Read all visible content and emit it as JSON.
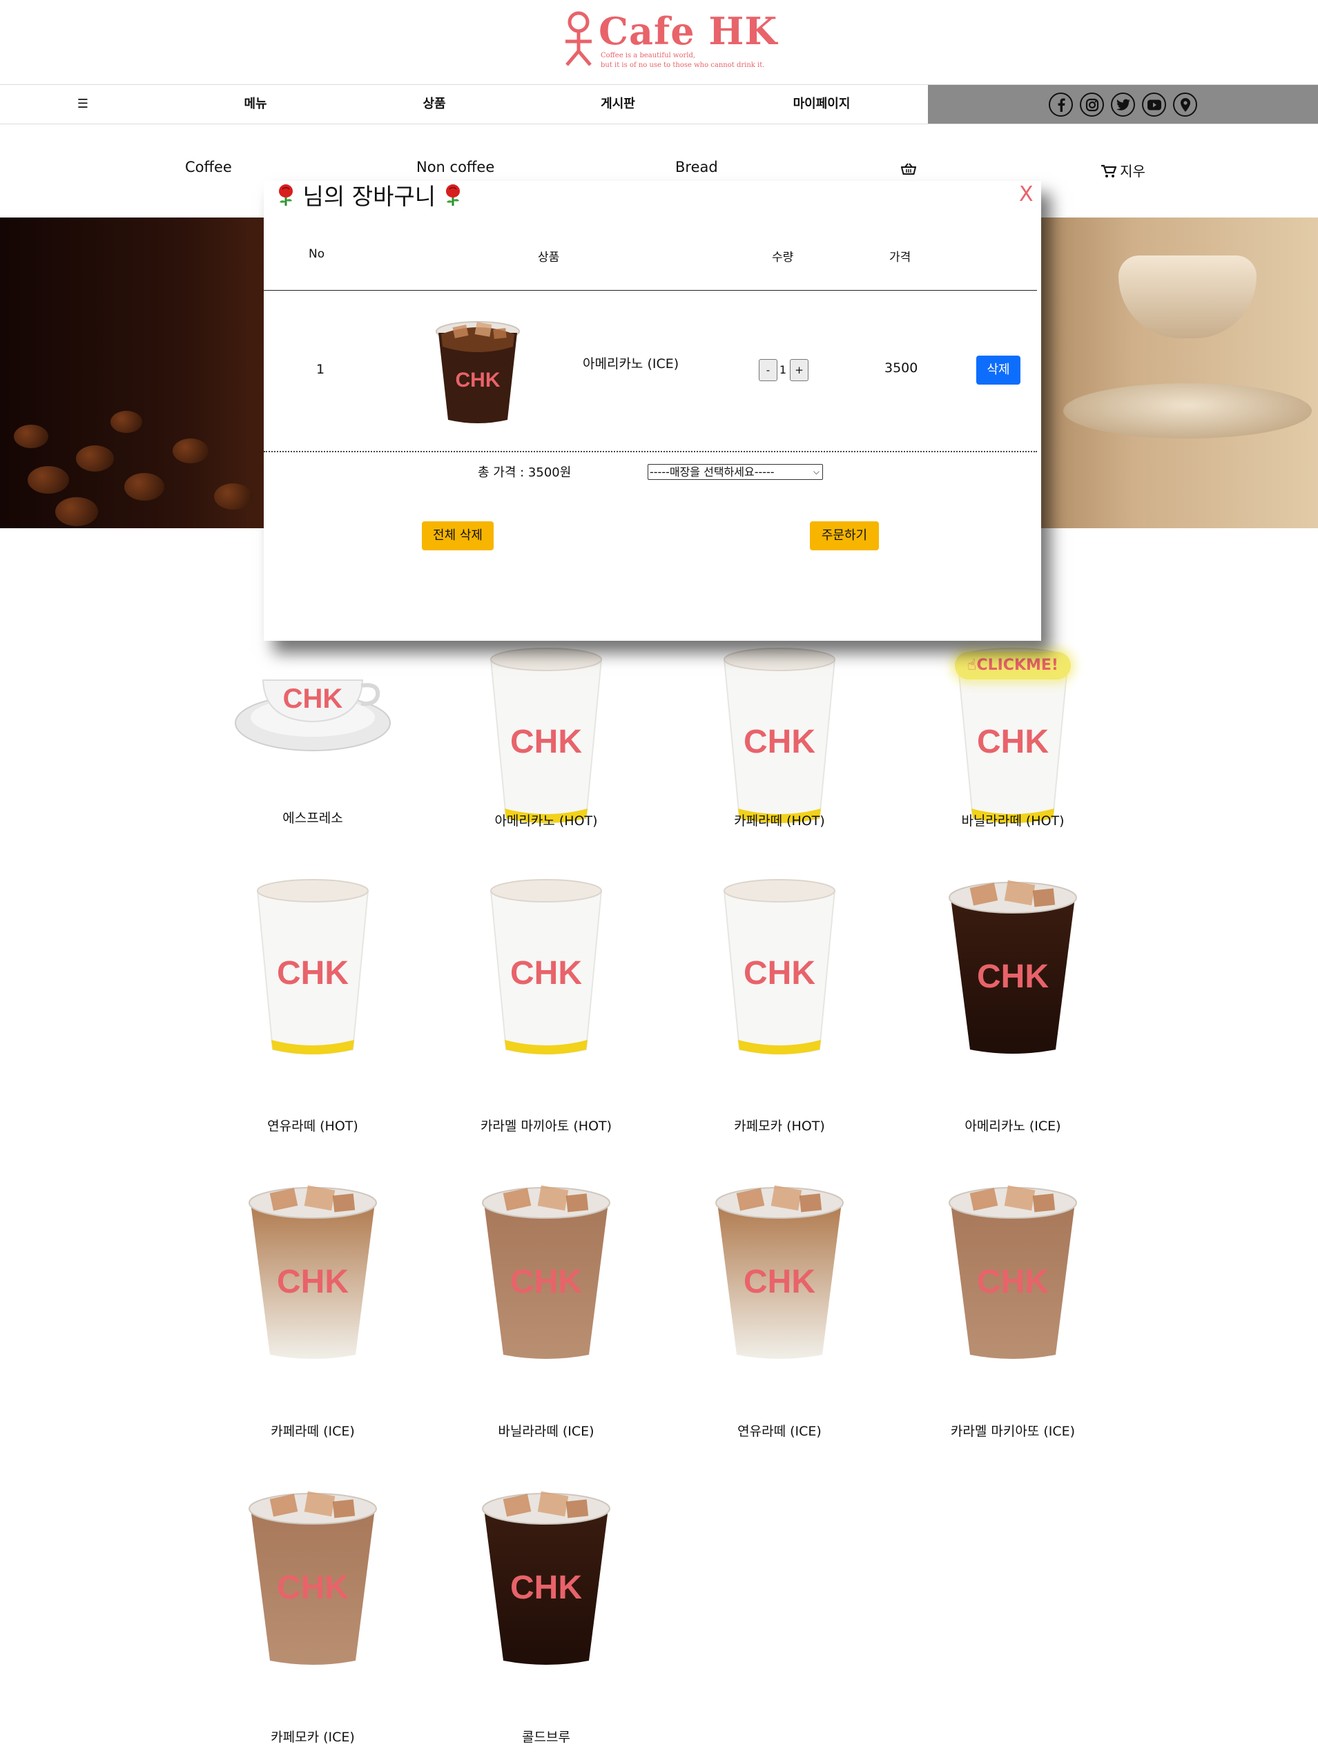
{
  "logo": {
    "title": "Cafe HK",
    "tagline_line1": "Coffee is a beautiful world,",
    "tagline_line2": "but it is of no use to those who cannot drink it."
  },
  "nav": {
    "menu_icon": "☰",
    "items": [
      "메뉴",
      "상품",
      "게시판",
      "마이페이지"
    ],
    "social_icons": [
      "facebook-icon",
      "instagram-icon",
      "twitter-icon",
      "youtube-icon",
      "location-pin-icon"
    ]
  },
  "categories": {
    "items": [
      "Coffee",
      "Non coffee",
      "Bread"
    ],
    "basket_icon": "basket-icon",
    "cart_label": "지우"
  },
  "colors": {
    "brand": "#e8636a",
    "social_bar": "#8a8a8a",
    "delete_button": "#0d6efd",
    "action_button": "#f7b500",
    "clickme_badge": "#f2e86a"
  },
  "cart_modal": {
    "title": "님의 장바구니",
    "title_icon": "rose-icon",
    "close_label": "X",
    "columns": [
      "No",
      "상품",
      "수량",
      "가격"
    ],
    "rows": [
      {
        "no": "1",
        "name": "아메리카노 (ICE)",
        "qty": "1",
        "price": "3500",
        "delete_label": "삭제"
      }
    ],
    "qty_minus": "-",
    "qty_plus": "+",
    "total_label": "총 가격 : 3500원",
    "store_select_placeholder": "-----매장을 선택하세요-----",
    "clear_all_label": "전체 삭제",
    "order_label": "주문하기"
  },
  "clickme_label": "CLICKME!",
  "products": [
    {
      "name": "에스프레소",
      "type": "espresso"
    },
    {
      "name": "아메리카노 (HOT)",
      "type": "hot"
    },
    {
      "name": "카페라떼 (HOT)",
      "type": "hot"
    },
    {
      "name": "바닐라라떼 (HOT)",
      "type": "hot"
    },
    {
      "name": "연유라떼 (HOT)",
      "type": "hot"
    },
    {
      "name": "카라멜 마끼아토 (HOT)",
      "type": "hot"
    },
    {
      "name": "카페모카 (HOT)",
      "type": "hot"
    },
    {
      "name": "아메리카노 (ICE)",
      "type": "ice-dark"
    },
    {
      "name": "카페라떼 (ICE)",
      "type": "ice-latte"
    },
    {
      "name": "바닐라라떼 (ICE)",
      "type": "ice-brown"
    },
    {
      "name": "연유라떼 (ICE)",
      "type": "ice-latte"
    },
    {
      "name": "카라멜 마키아또 (ICE)",
      "type": "ice-brown"
    },
    {
      "name": "카페모카 (ICE)",
      "type": "ice-brown"
    },
    {
      "name": "콜드브루",
      "type": "ice-dark"
    }
  ],
  "cup_brand": "CHK"
}
